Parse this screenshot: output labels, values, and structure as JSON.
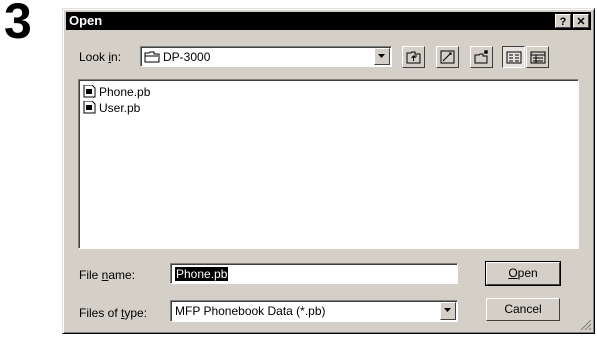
{
  "step_number": "3",
  "window": {
    "title": "Open",
    "help_glyph": "?",
    "close_glyph": "✕"
  },
  "look_in": {
    "label_pre": "Look ",
    "label_accel": "i",
    "label_post": "n:",
    "value": "DP-3000",
    "icon": "folder-icon"
  },
  "toolbar": {
    "buttons": [
      "up-one-level-icon",
      "desktop-icon",
      "new-folder-icon",
      "list-view-icon",
      "details-view-icon"
    ]
  },
  "files": [
    {
      "name": "Phone.pb",
      "icon": "phonebook-file-icon"
    },
    {
      "name": "User.pb",
      "icon": "phonebook-file-icon"
    }
  ],
  "file_name": {
    "label_pre": "File ",
    "label_accel": "n",
    "label_post": "ame:",
    "value": "Phone.pb"
  },
  "file_type": {
    "label_pre": "Files of ",
    "label_accel": "t",
    "label_post": "ype:",
    "value": "MFP Phonebook Data (*.pb)"
  },
  "buttons": {
    "open_accel": "O",
    "open_rest": "pen",
    "cancel": "Cancel"
  }
}
